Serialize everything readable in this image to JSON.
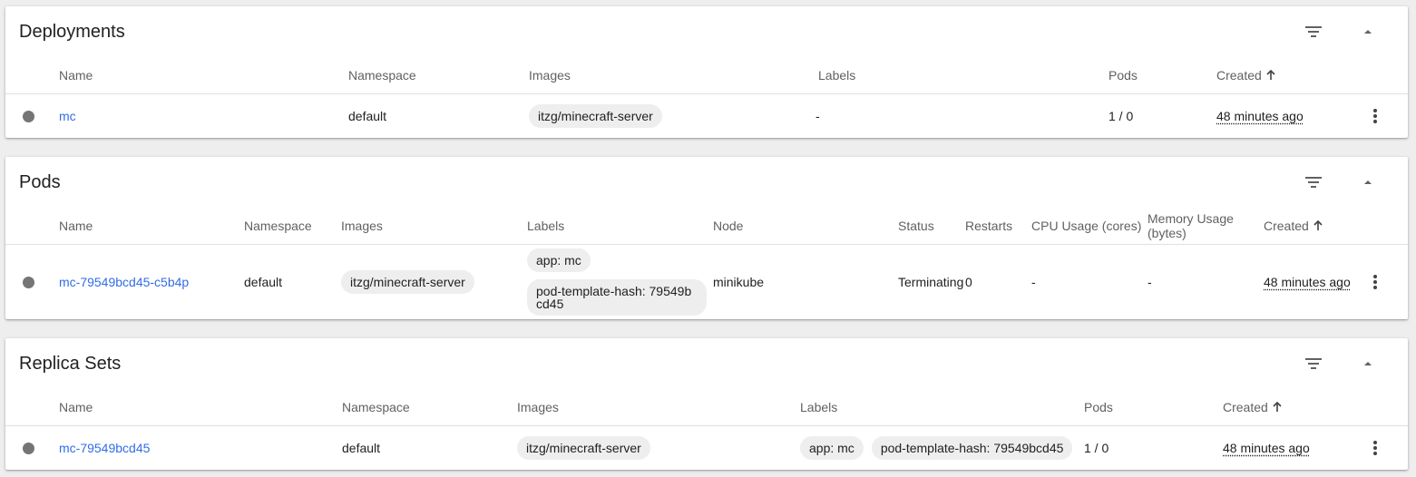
{
  "deployments": {
    "title": "Deployments",
    "columns": {
      "name": "Name",
      "namespace": "Namespace",
      "images": "Images",
      "labels": "Labels",
      "pods": "Pods",
      "created": "Created"
    },
    "rows": [
      {
        "name": "mc",
        "namespace": "default",
        "image": "itzg/minecraft-server",
        "labels": "-",
        "pods": "1 / 0",
        "created": "48 minutes ago"
      }
    ]
  },
  "pods": {
    "title": "Pods",
    "columns": {
      "name": "Name",
      "namespace": "Namespace",
      "images": "Images",
      "labels": "Labels",
      "node": "Node",
      "status": "Status",
      "restarts": "Restarts",
      "cpu": "CPU Usage (cores)",
      "memory": "Memory Usage (bytes)",
      "created": "Created"
    },
    "rows": [
      {
        "name": "mc-79549bcd45-c5b4p",
        "namespace": "default",
        "image": "itzg/minecraft-server",
        "label_1": "app: mc",
        "label_2": "pod-template-hash: 79549bcd45",
        "node": "minikube",
        "status": "Terminating",
        "restarts": "0",
        "cpu": "-",
        "memory": "-",
        "created": "48 minutes ago"
      }
    ]
  },
  "replica_sets": {
    "title": "Replica Sets",
    "columns": {
      "name": "Name",
      "namespace": "Namespace",
      "images": "Images",
      "labels": "Labels",
      "pods": "Pods",
      "created": "Created"
    },
    "rows": [
      {
        "name": "mc-79549bcd45",
        "namespace": "default",
        "image": "itzg/minecraft-server",
        "label_1": "app: mc",
        "label_2": "pod-template-hash: 79549bcd45",
        "pods": "1 / 0",
        "created": "48 minutes ago"
      }
    ]
  },
  "icons": {
    "filter": "filter-icon",
    "collapse": "chevron-up-icon",
    "sort": "arrow-up-icon",
    "more": "more-vert-icon",
    "status": "status-dot-icon"
  },
  "colors": {
    "link": "#326de6",
    "status_dot": "#757575",
    "chip_bg": "#eeeeee"
  }
}
